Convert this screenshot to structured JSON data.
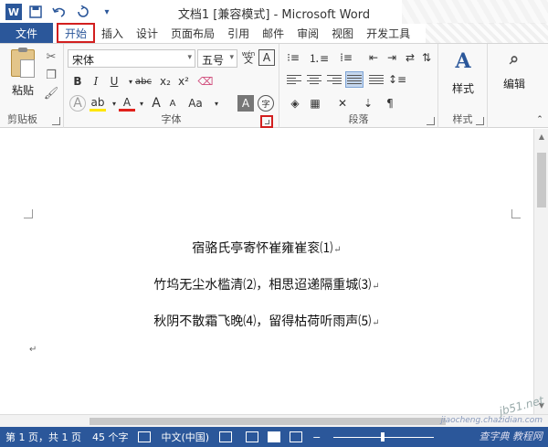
{
  "window": {
    "title": "文档1 [兼容模式] - Microsoft Word"
  },
  "qat": {
    "word_logo": "W",
    "save_icon": "save-icon",
    "undo_icon": "undo-icon",
    "redo_icon": "redo-icon"
  },
  "tabs": {
    "file": "文件",
    "items": [
      "开始",
      "插入",
      "设计",
      "页面布局",
      "引用",
      "邮件",
      "审阅",
      "视图",
      "开发工具"
    ]
  },
  "ribbon": {
    "clipboard": {
      "paste_label": "粘贴",
      "group_label": "剪贴板"
    },
    "font": {
      "font_name": "宋体",
      "font_size": "五号",
      "wen": "wén",
      "wen_char": "文",
      "a_box": "A",
      "bold": "B",
      "italic": "I",
      "underline": "U",
      "strike": "abc",
      "subscript": "x₂",
      "superscript": "x²",
      "grow": "A",
      "shrink": "A",
      "case": "Aa",
      "highlight": "ab",
      "color": "A",
      "shade": "A",
      "enclose": "字",
      "effect": "A",
      "group_label": "字体"
    },
    "paragraph": {
      "group_label": "段落"
    },
    "styles": {
      "label": "样式",
      "group_label": "样式"
    },
    "editing": {
      "label": "编辑"
    }
  },
  "document": {
    "lines": [
      "宿骆氏亭寄怀崔雍崔衮⑴",
      "竹坞无尘水槛清⑵，相思迢递隔重城⑶",
      "秋阴不散霜飞晚⑷，留得枯荷听雨声⑸"
    ],
    "para_mark": "↵"
  },
  "status": {
    "page": "第 1 页，共 1 页",
    "words": "45 个字",
    "language": "中文(中国)"
  },
  "watermarks": {
    "site1": "jiaocheng.chazidian.com",
    "site2": "jb51.net",
    "site3": "查字典 教程网"
  },
  "colors": {
    "accent": "#2b579a",
    "highlight_box": "#d21f1f"
  }
}
